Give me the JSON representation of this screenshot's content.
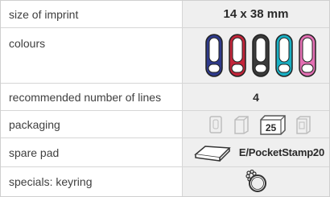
{
  "rows": [
    {
      "label": "size of imprint",
      "value": "14 x 38 mm"
    },
    {
      "label": "colours",
      "swatches": [
        {
          "icon": "stamp-blue-icon",
          "color": "#2e3a8c"
        },
        {
          "icon": "stamp-red-icon",
          "color": "#c3253a"
        },
        {
          "icon": "stamp-black-icon",
          "color": "#3a3a3a"
        },
        {
          "icon": "stamp-turquoise-icon",
          "color": "#18b0c4"
        },
        {
          "icon": "stamp-pink-icon",
          "color": "#e36fb3"
        }
      ]
    },
    {
      "label": "recommended number of lines",
      "value": "4"
    },
    {
      "label": "packaging",
      "icons": [
        "single-pack-icon",
        "double-pack-icon",
        "box-of-25-icon",
        "bulk-pack-icon"
      ],
      "box_count": "25"
    },
    {
      "label": "spare pad",
      "pad_code": "E/PocketStamp20",
      "icon": "ink-pad-icon"
    },
    {
      "label": "specials: keyring",
      "icon": "keyring-icon"
    }
  ]
}
